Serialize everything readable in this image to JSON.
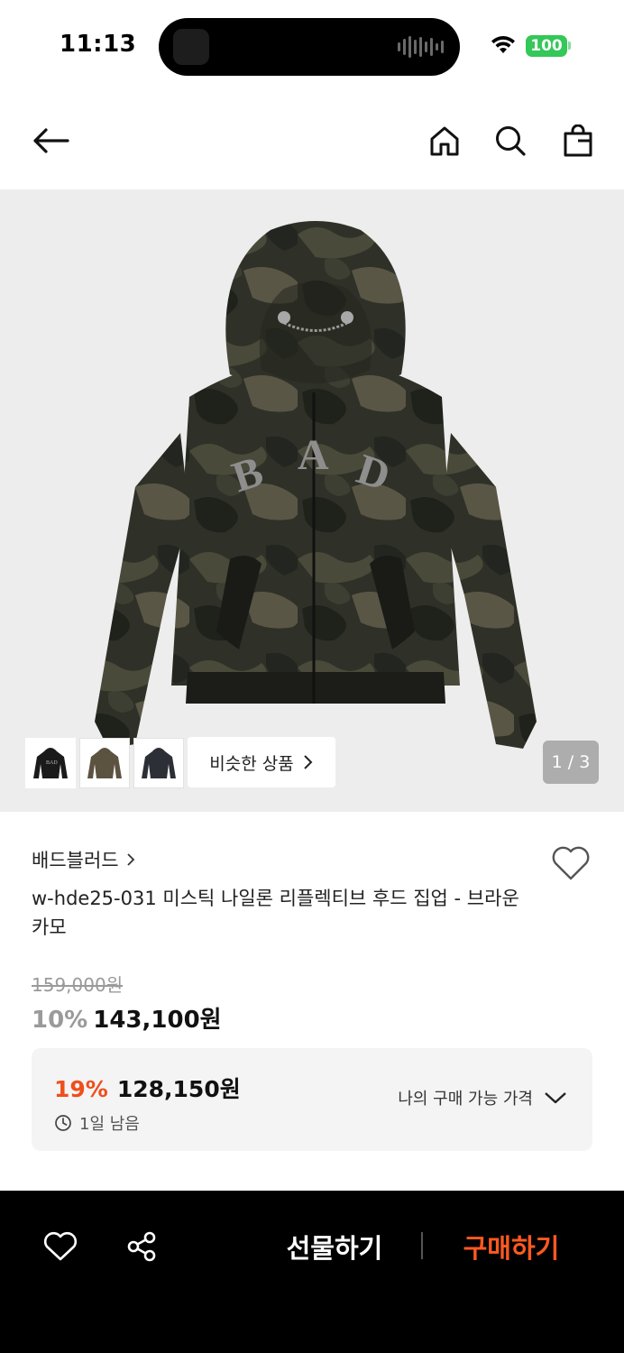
{
  "status_bar": {
    "time": "11:13",
    "battery": "100",
    "battery_color": "#34c759"
  },
  "nav": {
    "back_icon": "arrow-left-icon",
    "home_icon": "home-icon",
    "search_icon": "search-icon",
    "cart_icon": "shopping-bag-icon"
  },
  "gallery": {
    "page_indicator": "1 / 3",
    "similar_label": "비슷한 상품",
    "thumbnails": [
      "black",
      "brown",
      "navy"
    ]
  },
  "product": {
    "brand": "배드블러드",
    "name": "w-hde25-031 미스틱 나일론 리플렉티브 후드 집업 - 브라운카모",
    "original_price": "159,000원",
    "discount_rate": "10%",
    "sale_price": "143,100원"
  },
  "coupon": {
    "rate": "19%",
    "price": "128,150원",
    "remaining": "1일 남음",
    "toggle_label": "나의 구매 가능 가격",
    "accent_color": "#f04e1a"
  },
  "bottom_bar": {
    "gift_label": "선물하기",
    "buy_label": "구매하기",
    "buy_color": "#ff5a1f"
  }
}
